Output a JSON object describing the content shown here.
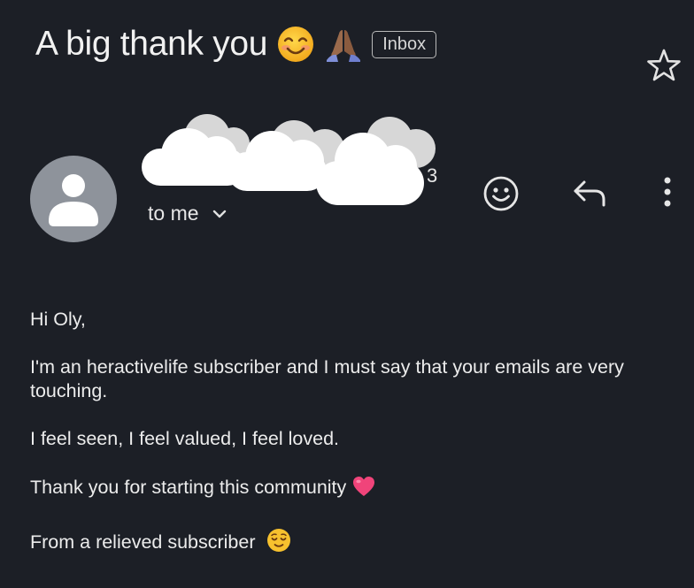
{
  "email": {
    "subject": "A big thank you",
    "subject_emojis": [
      "smiling-face-with-smiling-eyes",
      "folded-hands"
    ],
    "label_badge": "Inbox",
    "sender_obscured": true,
    "sender_visible_fragment": "3",
    "recipient_label": "to me",
    "body": {
      "greeting": "Hi Oly,",
      "paragraph1": "I'm an heractivelife subscriber and I must say that your emails are very touching.",
      "paragraph2": "I feel seen, I feel valued, I feel loved.",
      "paragraph3": "Thank you for starting this community",
      "paragraph3_emoji": "heart-icon",
      "signoff": "From a relieved subscriber",
      "signoff_emoji": "relieved-face-icon"
    }
  },
  "icons": {
    "star": "star-outline-icon",
    "react": "emoji-smile-icon",
    "reply": "reply-icon",
    "more": "more-vert-icon",
    "avatar": "default-avatar-icon",
    "expand": "chevron-down-icon"
  },
  "colors": {
    "background": "#1c1f26",
    "text": "#ececec",
    "avatar": "#8e939b",
    "heart": "#f0447a",
    "emoji_yellow": "#f7c12e"
  }
}
